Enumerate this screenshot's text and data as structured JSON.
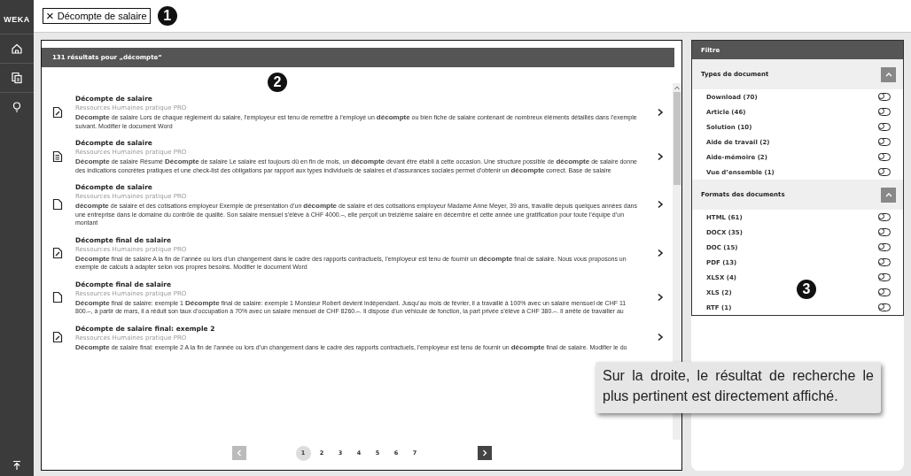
{
  "sidebar": {
    "logo": "WEKA",
    "items": [
      {
        "kind": "home",
        "selected": false
      },
      {
        "kind": "documents",
        "selected": false
      },
      {
        "kind": "idea",
        "selected": false
      }
    ]
  },
  "search_tag": {
    "close": "×",
    "label": "Décompte de salaire"
  },
  "callouts": [
    "1",
    "2",
    "3"
  ],
  "results": {
    "header": "131 résultats pour „décompte“",
    "items": [
      {
        "kind": "edit",
        "title": "Décompte de salaire",
        "source": "Ressources Humaines pratique PRO",
        "snippet": "**Décompte** de salaire Lors de chaque règlement du salaire, l’employeur est tenu de remettre à l’employé un **décompte** ou bien fiche de salaire contenant de nombreux éléments détaillés dans l’exemple suivant. Modifier le document Word"
      },
      {
        "kind": "text",
        "title": "Décompte de salaire",
        "source": "Ressources Humaines pratique PRO",
        "snippet": "**Décompte** de salaire Résumé **Décompte** de salaire Le salaire est toujours dû en fin de mois, un **décompte** devant être établi à cette occasion. Une structure possible de **décompte** de salaire donne des indications concrètes pratiques et une check-list des obligations par rapport aux types individuels de salaires et d’assurances sociales permet d’obtenir un **décompte** correct. Base de salaire"
      },
      {
        "kind": "blank",
        "title": "Décompte de salaire",
        "source": "Ressources Humaines pratique PRO",
        "snippet": "**décompte** de salaire et des cotisations employeur Exemple de présentation d’un **décompte** de salaire et des cotisations employeur Madame Anne Meyer, 39 ans, travaille depuis quelques années dans une entreprise dans le domaine du contrôle de qualité. Son salaire mensuel s’élève à CHF 4000.–, elle perçoit un treizième salaire en décembre et cette année une gratification pour toute l’équipe d’un montant"
      },
      {
        "kind": "edit",
        "title": "Décompte final de salaire",
        "source": "Ressources Humaines pratique PRO",
        "snippet": "**Décompte** final de salaire A la fin de l’année ou lors d’un changement dans le cadre des rapports contractuels, l’employeur est tenu de fournir un **décompte** final de salaire. Nous vous proposons un exemple de calculs à adapter selon vos propres besoins. Modifier le document Word"
      },
      {
        "kind": "blank",
        "title": "Décompte final de salaire",
        "source": "Ressources Humaines pratique PRO",
        "snippet": "**Décompte** final de salaire: exemple 1 **Décompte** final de salaire: exemple 1 Monsieur Robert devient indépendant. Jusqu’au mois de février, il a travaillé à 100% avec un salaire mensuel de CHF 11 800.–, à partir de mars, il a réduit son taux d’occupation à 70% avec un salaire mensuel de CHF 8260.–. Il dispose d’un véhicule de fonction, la part privée s’élève à CHF 380.–. Il arrête de travailler au"
      },
      {
        "kind": "edit",
        "title": "Décompte de salaire final: exemple 2",
        "source": "Ressources Humaines pratique PRO",
        "snippet": "**Décompte** de salaire final: exemple 2 A la fin de l’année ou lors d’un changement dans le cadre des rapports contractuels, l’employeur est tenu de fournir un **décompte** final de salaire. Modifier le do"
      }
    ],
    "pagination": {
      "prev": {
        "disabled": true
      },
      "pages": [
        {
          "label": "1",
          "selected": true
        },
        {
          "label": "2",
          "selected": false
        },
        {
          "label": "3",
          "selected": false
        },
        {
          "label": "4",
          "selected": false
        },
        {
          "label": "5",
          "selected": false
        },
        {
          "label": "6",
          "selected": false
        },
        {
          "label": "7",
          "selected": false
        }
      ],
      "next": {
        "disabled": false
      }
    }
  },
  "filter": {
    "header": "Filtre",
    "groups": [
      {
        "title": "Types de document",
        "expanded": true,
        "options": [
          {
            "label": "Download (70)",
            "on": false
          },
          {
            "label": "Article (46)",
            "on": false
          },
          {
            "label": "Solution (10)",
            "on": false
          },
          {
            "label": "Aide de travail (2)",
            "on": false
          },
          {
            "label": "Aide-mémoire (2)",
            "on": false
          },
          {
            "label": "Vue d’ensemble (1)",
            "on": false
          }
        ]
      },
      {
        "title": "Formats des documents",
        "expanded": true,
        "options": [
          {
            "label": "HTML (61)",
            "on": false
          },
          {
            "label": "DOCX (35)",
            "on": false
          },
          {
            "label": "DOC (15)",
            "on": false
          },
          {
            "label": "PDF (13)",
            "on": false
          },
          {
            "label": "XLSX (4)",
            "on": false
          },
          {
            "label": "XLS (2)",
            "on": false
          },
          {
            "label": "RTF (1)",
            "on": false
          }
        ]
      }
    ]
  },
  "tooltip": "Sur la droite, le résultat de recherche le plus pertinent est directement affiché."
}
